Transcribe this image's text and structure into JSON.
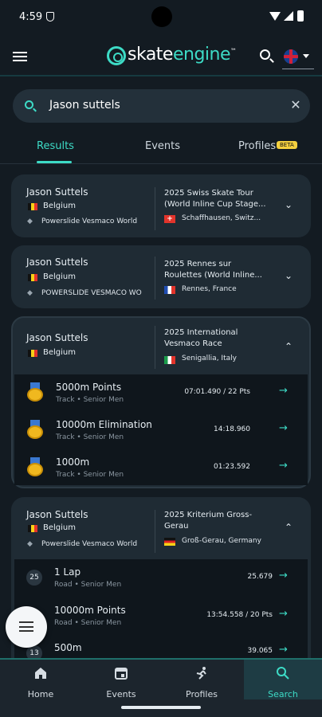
{
  "status": {
    "time": "4:59"
  },
  "app": {
    "logo_left": "skate",
    "logo_right": "engine",
    "logo_tm": "™"
  },
  "search": {
    "value": "Jason suttels",
    "clear": "✕"
  },
  "tabs": [
    {
      "label": "Results"
    },
    {
      "label": "Events"
    },
    {
      "label": "Profiles"
    }
  ],
  "beta_badge": "BETA",
  "cards": [
    {
      "name": "Jason Suttels",
      "country": "Belgium",
      "team": "Powerslide Vesmaco World",
      "event": "2025 Swiss Skate Tour (World Inline Cup Stage...",
      "location": "Schaffhausen, Switz...",
      "chevron": "⌄"
    },
    {
      "name": "Jason Suttels",
      "country": "Belgium",
      "team": "POWERSLIDE VESMACO WO",
      "event": "2025 Rennes sur Roulettes (World Inline...",
      "location": "Rennes, France",
      "chevron": "⌄"
    },
    {
      "name": "Jason Suttels",
      "country": "Belgium",
      "event": "2025 International Vesmaco Race",
      "location": "Senigallia, Italy",
      "chevron": "⌃",
      "results": [
        {
          "title": "5000m Points",
          "sub": "Track • Senior Men",
          "value": "07:01.490 / 22 Pts"
        },
        {
          "title": "10000m Elimination",
          "sub": "Track • Senior Men",
          "value": "14:18.960"
        },
        {
          "title": "1000m",
          "sub": "Track • Senior Men",
          "value": "01:23.592"
        }
      ]
    },
    {
      "name": "Jason Suttels",
      "country": "Belgium",
      "team": "Powerslide Vesmaco World",
      "event": "2025 Kriterium Gross-Gerau",
      "location": "Groß-Gerau, Germany",
      "chevron": "⌃",
      "results": [
        {
          "rank": "25",
          "title": "1 Lap",
          "sub": "Road • Senior Men",
          "value": "25.679"
        },
        {
          "rank": "",
          "title": "10000m Points",
          "sub": "Road • Senior Men",
          "value": "13:54.558 / 20 Pts"
        },
        {
          "rank": "13",
          "title": "500m",
          "sub": "",
          "value": "39.065"
        }
      ]
    }
  ],
  "nav": [
    {
      "label": "Home"
    },
    {
      "label": "Events"
    },
    {
      "label": "Profiles"
    },
    {
      "label": "Search"
    }
  ],
  "colors": {
    "accent": "#3ddbc6",
    "background": "#131b22",
    "card": "#1f2b34"
  }
}
